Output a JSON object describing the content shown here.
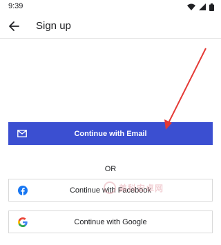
{
  "status_bar": {
    "time": "9:39",
    "icons": [
      "wifi-icon",
      "signal-icon",
      "battery-icon"
    ]
  },
  "app_bar": {
    "title": "Sign up",
    "back_icon": "arrow-back-icon"
  },
  "buttons": {
    "email": {
      "label": "Continue with Email",
      "icon": "mail-icon",
      "color": "#3b4fd1"
    },
    "facebook": {
      "label": "Continue with Facebook",
      "icon": "facebook-icon",
      "color": "#1877f2"
    },
    "google": {
      "label": "Continue with Google",
      "icon": "google-icon"
    }
  },
  "divider": {
    "or_label": "OR"
  },
  "annotation": {
    "color": "#e53935"
  },
  "watermark": {
    "text": "美科安卓网"
  }
}
